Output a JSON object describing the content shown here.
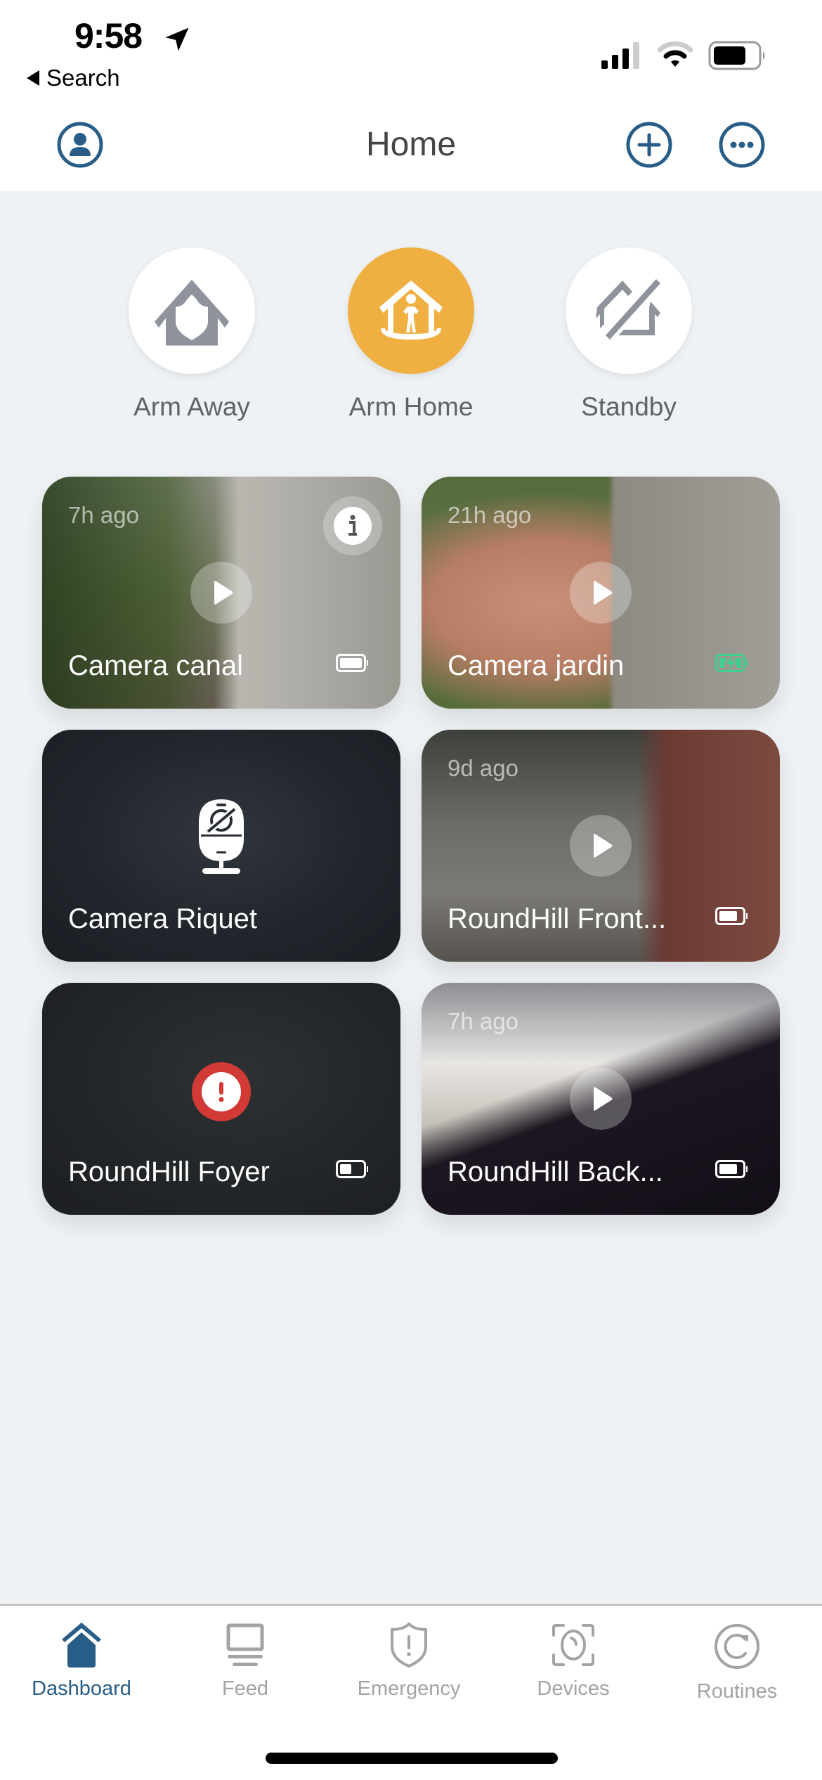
{
  "status_bar": {
    "time": "9:58",
    "back_label": "Search",
    "location_icon": "location-arrow-icon",
    "signal_icon": "cellular-signal-icon",
    "wifi_icon": "wifi-icon",
    "battery_icon": "battery-icon"
  },
  "header": {
    "title": "Home",
    "left_icon": "profile-icon",
    "right_icons": [
      "add-icon",
      "more-icon"
    ]
  },
  "modes": [
    {
      "label": "Arm Away",
      "icon": "shield-house-icon",
      "active": false
    },
    {
      "label": "Arm Home",
      "icon": "person-house-icon",
      "active": true
    },
    {
      "label": "Standby",
      "icon": "house-slash-icon",
      "active": false
    }
  ],
  "colors": {
    "accent": "#285d87",
    "active_mode": "#efb041",
    "alert": "#d23a35",
    "charging": "#3fcf8e",
    "inactive_tab": "#a3a3a3",
    "background": "#eef2f5"
  },
  "cameras": [
    {
      "name": "Camera canal",
      "time": "7h ago",
      "battery": "full",
      "has_info": true,
      "state": "preview"
    },
    {
      "name": "Camera jardin",
      "time": "21h ago",
      "battery": "charging",
      "has_info": false,
      "state": "preview"
    },
    {
      "name": "Camera Riquet",
      "time": "",
      "battery": "",
      "has_info": false,
      "state": "privacy"
    },
    {
      "name": "RoundHill Front...",
      "time": "9d ago",
      "battery": "high",
      "has_info": false,
      "state": "preview"
    },
    {
      "name": "RoundHill Foyer",
      "time": "",
      "battery": "half",
      "has_info": false,
      "state": "error"
    },
    {
      "name": "RoundHill Back...",
      "time": "7h ago",
      "battery": "high",
      "has_info": false,
      "state": "preview"
    }
  ],
  "tabs": [
    {
      "label": "Dashboard",
      "icon": "home-icon",
      "active": true
    },
    {
      "label": "Feed",
      "icon": "feed-icon",
      "active": false
    },
    {
      "label": "Emergency",
      "icon": "emergency-shield-icon",
      "active": false
    },
    {
      "label": "Devices",
      "icon": "devices-camera-icon",
      "active": false
    },
    {
      "label": "Routines",
      "icon": "routines-icon",
      "active": false
    }
  ]
}
